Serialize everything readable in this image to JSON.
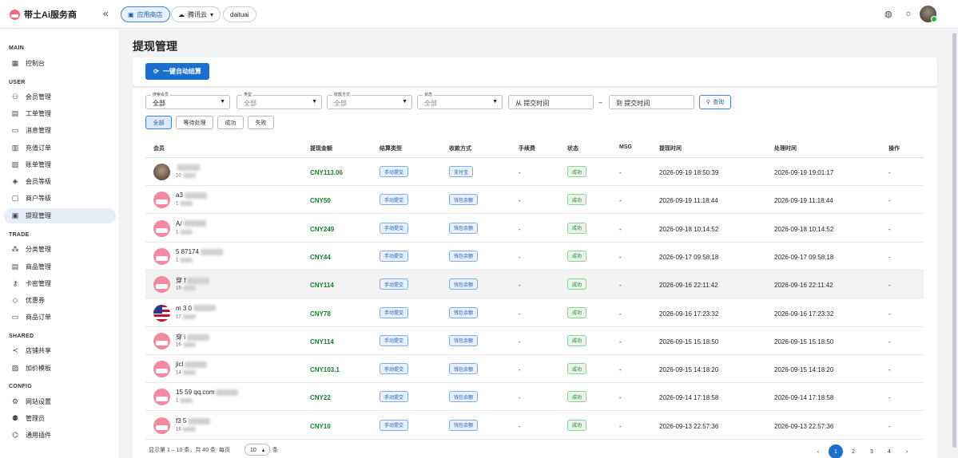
{
  "app": {
    "name": "带土Ai服务商",
    "collapse_icon": "double-chevron-left-icon"
  },
  "header": {
    "pills": [
      {
        "label": "应用商店",
        "icon": "store-icon",
        "active": true
      },
      {
        "label": "腾讯云",
        "icon": "cloud-icon",
        "dropdown": "▾"
      },
      {
        "label": "daituai"
      }
    ],
    "icons": [
      "globe-icon",
      "sun-icon",
      "user-avatar"
    ]
  },
  "sidebar": {
    "sections": [
      {
        "title": "MAIN",
        "items": [
          {
            "label": "控制台",
            "icon": "dashboard-icon"
          }
        ]
      },
      {
        "title": "USER",
        "items": [
          {
            "label": "会员管理",
            "icon": "users-icon"
          },
          {
            "label": "工单管理",
            "icon": "ticket-icon"
          },
          {
            "label": "消息管理",
            "icon": "message-icon"
          },
          {
            "label": "充值订单",
            "icon": "receipt-icon"
          },
          {
            "label": "账单管理",
            "icon": "bill-icon"
          },
          {
            "label": "会员等级",
            "icon": "badge-icon"
          },
          {
            "label": "商户等级",
            "icon": "shop-icon"
          },
          {
            "label": "提现管理",
            "icon": "withdraw-icon",
            "active": true
          }
        ]
      },
      {
        "title": "TRADE",
        "items": [
          {
            "label": "分类管理",
            "icon": "category-icon"
          },
          {
            "label": "商品管理",
            "icon": "box-icon"
          },
          {
            "label": "卡密管理",
            "icon": "key-icon"
          },
          {
            "label": "优惠券",
            "icon": "coupon-icon"
          },
          {
            "label": "商品订单",
            "icon": "cart-icon"
          }
        ]
      },
      {
        "title": "SHARED",
        "items": [
          {
            "label": "店铺共享",
            "icon": "share-icon"
          },
          {
            "label": "加价模板",
            "icon": "template-icon"
          }
        ]
      },
      {
        "title": "CONFIG",
        "items": [
          {
            "label": "网站设置",
            "icon": "settings-icon"
          },
          {
            "label": "管理员",
            "icon": "admin-icon"
          },
          {
            "label": "通用插件",
            "icon": "plugin-icon"
          }
        ]
      }
    ]
  },
  "page": {
    "title": "提现管理",
    "auto_settle_button": "一键自动结算"
  },
  "filters": {
    "member": {
      "label": "搜索会员",
      "value": "全部"
    },
    "type": {
      "label": "类型",
      "value": "全部"
    },
    "method": {
      "label": "收款方式",
      "value": "全部"
    },
    "status": {
      "label": "状态",
      "value": "全部"
    },
    "from_placeholder": "从 提交时间",
    "to_placeholder": "到 提交时间",
    "range_sep": "–",
    "query_button": "查询",
    "tabs": [
      "全部",
      "等待处理",
      "成功",
      "失败"
    ]
  },
  "table": {
    "columns": [
      "会员",
      "提现金额",
      "结算类型",
      "收款方式",
      "手续费",
      "状态",
      "MSG",
      "提现时间",
      "处理时间",
      "操作"
    ],
    "rows": [
      {
        "avatar": "photo",
        "name": "",
        "sub": "10",
        "amount": "CNY113.06",
        "settle": "手动提交",
        "method": "支付宝",
        "fee": "-",
        "status": "成功",
        "msg": "-",
        "time": "2026-09-19 18:50:39",
        "done": "2026-09-19 19:01:17",
        "op": "-"
      },
      {
        "avatar": "robot",
        "name": "a3",
        "sub": "1",
        "amount": "CNY50",
        "settle": "手动提交",
        "method": "钱包余额",
        "fee": "-",
        "status": "成功",
        "msg": "-",
        "time": "2026-09-19 11:18:44",
        "done": "2026-09-19 11:18:44",
        "op": "-"
      },
      {
        "avatar": "robot",
        "name": "A/",
        "sub": "1",
        "amount": "CNY249",
        "settle": "手动提交",
        "method": "钱包余额",
        "fee": "-",
        "status": "成功",
        "msg": "-",
        "time": "2026-09-18 10:14:52",
        "done": "2026-09-18 10:14:52",
        "op": "-"
      },
      {
        "avatar": "robot",
        "name": "5 87174",
        "sub": "1",
        "amount": "CNY44",
        "settle": "手动提交",
        "method": "钱包余额",
        "fee": "-",
        "status": "成功",
        "msg": "-",
        "time": "2026-09-17 09:58:18",
        "done": "2026-09-17 09:58:18",
        "op": "-"
      },
      {
        "avatar": "robot",
        "name": "穿 f",
        "sub": "16",
        "amount": "CNY114",
        "settle": "手动提交",
        "method": "钱包余额",
        "fee": "-",
        "status": "成功",
        "msg": "-",
        "time": "2026-09-16 22:11:42",
        "done": "2026-09-16 22:11:42",
        "op": "-",
        "highlight": true
      },
      {
        "avatar": "flag",
        "name": "m 3 0",
        "sub": "17",
        "amount": "CNY78",
        "settle": "手动提交",
        "method": "钱包余额",
        "fee": "-",
        "status": "成功",
        "msg": "-",
        "time": "2026-09-16 17:23:32",
        "done": "2026-09-16 17:23:32",
        "op": "-"
      },
      {
        "avatar": "robot",
        "name": "穿 i",
        "sub": "16",
        "amount": "CNY114",
        "settle": "手动提交",
        "method": "钱包余额",
        "fee": "-",
        "status": "成功",
        "msg": "-",
        "time": "2026-09-15 15:18:50",
        "done": "2026-09-15 15:18:50",
        "op": "-"
      },
      {
        "avatar": "robot",
        "name": "jicl",
        "sub": "14",
        "amount": "CNY103.1",
        "settle": "手动提交",
        "method": "钱包余额",
        "fee": "-",
        "status": "成功",
        "msg": "-",
        "time": "2026-09-15 14:18:20",
        "done": "2026-09-15 14:18:20",
        "op": "-"
      },
      {
        "avatar": "robot",
        "name": "15 59 qq.com",
        "sub": "1",
        "amount": "CNY22",
        "settle": "手动提交",
        "method": "钱包余额",
        "fee": "-",
        "status": "成功",
        "msg": "-",
        "time": "2026-09-14 17:18:58",
        "done": "2026-09-14 17:18:58",
        "op": "-"
      },
      {
        "avatar": "robot",
        "name": "f3 5",
        "sub": "16",
        "amount": "CNY10",
        "settle": "手动提交",
        "method": "钱包余额",
        "fee": "-",
        "status": "成功",
        "msg": "-",
        "time": "2026-09-13 22:57:36",
        "done": "2026-09-13 22:57:36",
        "op": "-"
      }
    ]
  },
  "pagination": {
    "summary": "显示第 1 – 10 条，共 40 条",
    "per_page_label": "每页",
    "per_page": "10",
    "per_page_arrow": "▴",
    "unit": "条",
    "prev": "‹",
    "pages": [
      "1",
      "2",
      "3",
      "4"
    ],
    "next": "›",
    "current": "1"
  }
}
